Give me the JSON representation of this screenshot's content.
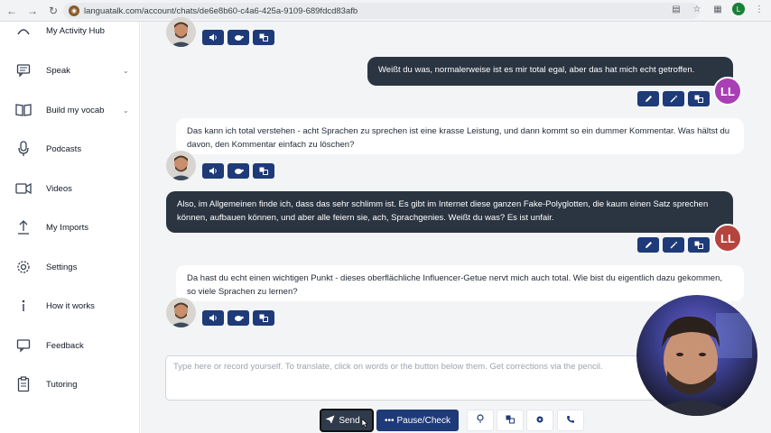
{
  "browser": {
    "url": "languatalk.com/account/chats/de6e8b60-c4a6-425a-9109-689fdcd83afb",
    "profile_initial": "L"
  },
  "sidebar": {
    "items": [
      {
        "label": "My Activity Hub",
        "icon": "dashboard-icon"
      },
      {
        "label": "Speak",
        "icon": "chat-icon",
        "expandable": true
      },
      {
        "label": "Build my vocab",
        "icon": "book-icon",
        "expandable": true
      },
      {
        "label": "Podcasts",
        "icon": "microphone-icon"
      },
      {
        "label": "Videos",
        "icon": "video-icon"
      },
      {
        "label": "My Imports",
        "icon": "upload-icon"
      },
      {
        "label": "Settings",
        "icon": "gear-icon"
      },
      {
        "label": "How it works",
        "icon": "info-icon"
      },
      {
        "label": "Feedback",
        "icon": "feedback-icon"
      },
      {
        "label": "Tutoring",
        "icon": "clipboard-icon"
      }
    ]
  },
  "messages": [
    {
      "role": "user",
      "text": "Weißt du was, normalerweise ist es mir total egal, aber das hat mich echt getroffen.",
      "avatar": "LL"
    },
    {
      "role": "bot",
      "text": "Das kann ich total verstehen - acht Sprachen zu sprechen ist eine krasse Leistung, und dann kommt so ein dummer Kommentar. Was hältst du davon, den Kommentar einfach zu löschen?"
    },
    {
      "role": "user",
      "text": "Also, im Allgemeinen finde ich, dass das sehr schlimm ist. Es gibt im Internet diese ganzen Fake-Polyglotten, die kaum einen Satz sprechen können, aufbauen können, und aber alle feiern sie, ach, Sprachgenies. Weißt du was? Es ist unfair.",
      "avatar": "LL"
    },
    {
      "role": "bot",
      "text": "Da hast du echt einen wichtigen Punkt - dieses oberflächliche Influencer-Getue nervt mich auch total. Wie bist du eigentlich dazu gekommen, so viele Sprachen zu lernen?"
    }
  ],
  "colors": {
    "user_bubble": "#2b3441",
    "action_button": "#1e3a78",
    "avatar_ll_1": "#a83fb4",
    "avatar_ll_2": "#b5443f"
  },
  "composer": {
    "placeholder": "Type here or record yourself. To translate, click on words or the button below them. Get corrections via the pencil.",
    "send_label": "Send",
    "pause_label": "Pause/Check"
  }
}
